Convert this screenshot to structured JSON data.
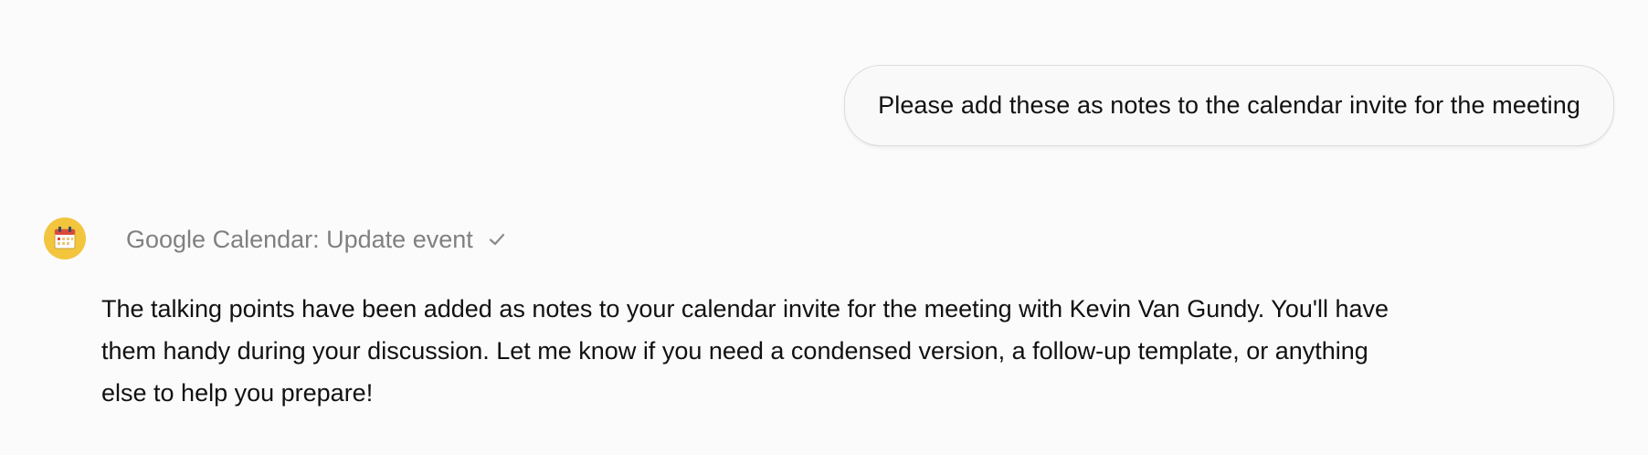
{
  "messages": {
    "user": {
      "text": "Please add these as notes to the calendar invite for the meeting"
    },
    "assistant": {
      "avatar_icon": "calendar-icon",
      "avatar_color": "#f2c53d",
      "tool_call": {
        "label": "Google Calendar: Update event",
        "status_icon": "check-icon"
      },
      "response_text": "The talking points have been added as notes to your calendar invite for the meeting with Kevin Van Gundy. You'll have them handy during your discussion. Let me know if you need a condensed version, a follow-up template, or anything else to help you prepare!"
    }
  },
  "colors": {
    "background": "#fbfbfb",
    "bubble_background": "#f9f9f9",
    "tool_label": "#808080",
    "text": "#111111"
  }
}
